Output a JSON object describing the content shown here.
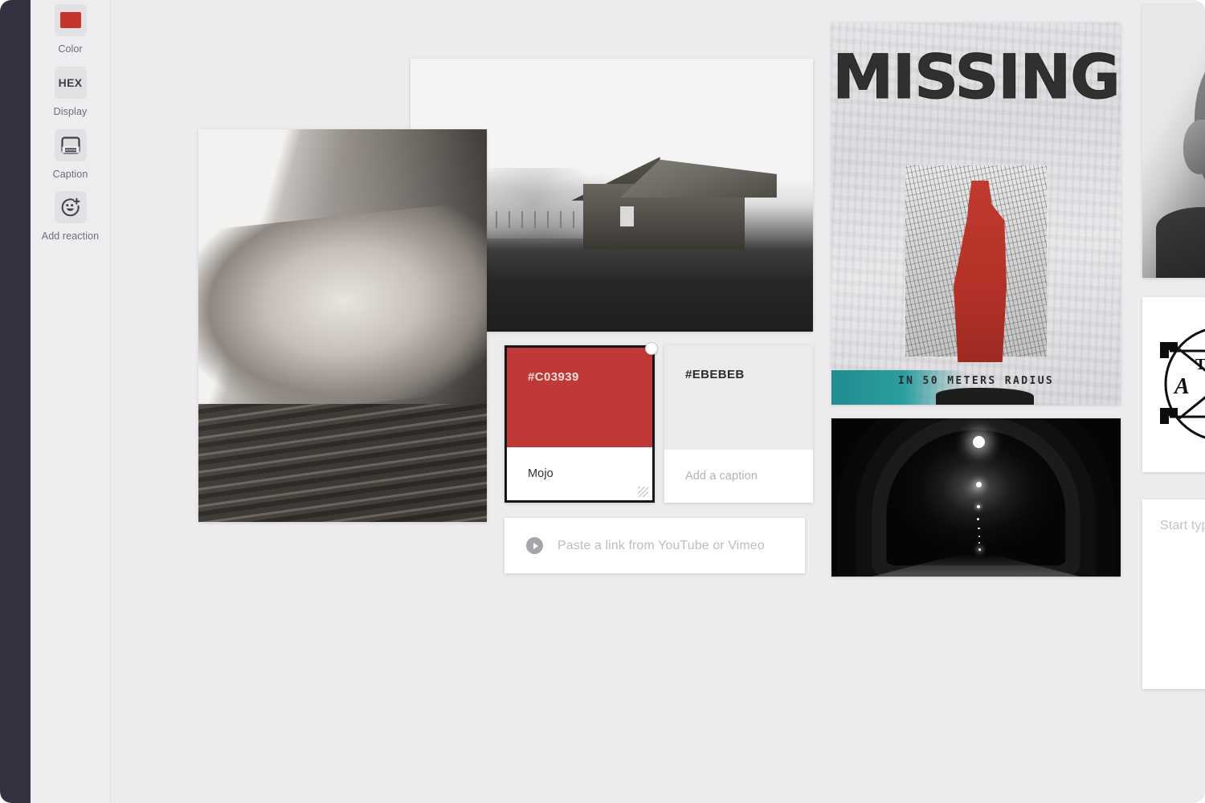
{
  "sidebar": {
    "tools": [
      {
        "label": "Color",
        "icon": "color-swatch-icon",
        "swatch": "#C4342F"
      },
      {
        "label": "Display",
        "icon": "hex-icon",
        "glyph": "HEX"
      },
      {
        "label": "Caption",
        "icon": "caption-icon"
      },
      {
        "label": "Add reaction",
        "icon": "smiley-plus-icon"
      }
    ]
  },
  "canvas": {
    "media": [
      {
        "name": "hands-with-ring-photo",
        "alt": "Black and white photo of two hands clasped, engagement ring on finger, resting on weathered wood"
      },
      {
        "name": "foggy-cabin-photo",
        "alt": "Black and white photo of a weathered wooden cabin in a foggy field"
      },
      {
        "name": "missing-poster-photo",
        "alt": "Torn paste-up poster reading MISSING with a red figure silhouette"
      },
      {
        "name": "dark-tunnel-photo",
        "alt": "Black and white photo looking down a dark tunnel with receding lights"
      },
      {
        "name": "portrait-photo",
        "alt": "Black and white portrait of a bald man, cropped at the right edge"
      },
      {
        "name": "occult-symbol-image",
        "alt": "Black and white alchemical circle-and-X emblem with lettering"
      }
    ],
    "poster": {
      "headline": "MISSING",
      "subline": "IN 50 METERS RADIUS"
    },
    "color_cards": [
      {
        "hex": "#C03939",
        "hex_label": "#C03939",
        "caption": "Mojo",
        "caption_placeholder": "Add a caption",
        "hex_text_color": "#f0ddd9",
        "selected": true
      },
      {
        "hex": "#EBEBEB",
        "hex_label": "#EBEBEB",
        "caption": "",
        "caption_placeholder": "Add a caption",
        "hex_text_color": "#2b2b30",
        "selected": false
      }
    ],
    "video_card": {
      "icon": "play-circle-icon",
      "placeholder": "Paste a link from YouTube or Vimeo"
    },
    "text_card": {
      "placeholder": "Start typing"
    }
  },
  "theme": {
    "rail_dark": "#323240",
    "rail_light": "#ededef",
    "canvas_bg": "#ececee",
    "accent_red": "#C03939",
    "grey_swatch": "#EBEBEB",
    "selection_border": "#17171a"
  }
}
